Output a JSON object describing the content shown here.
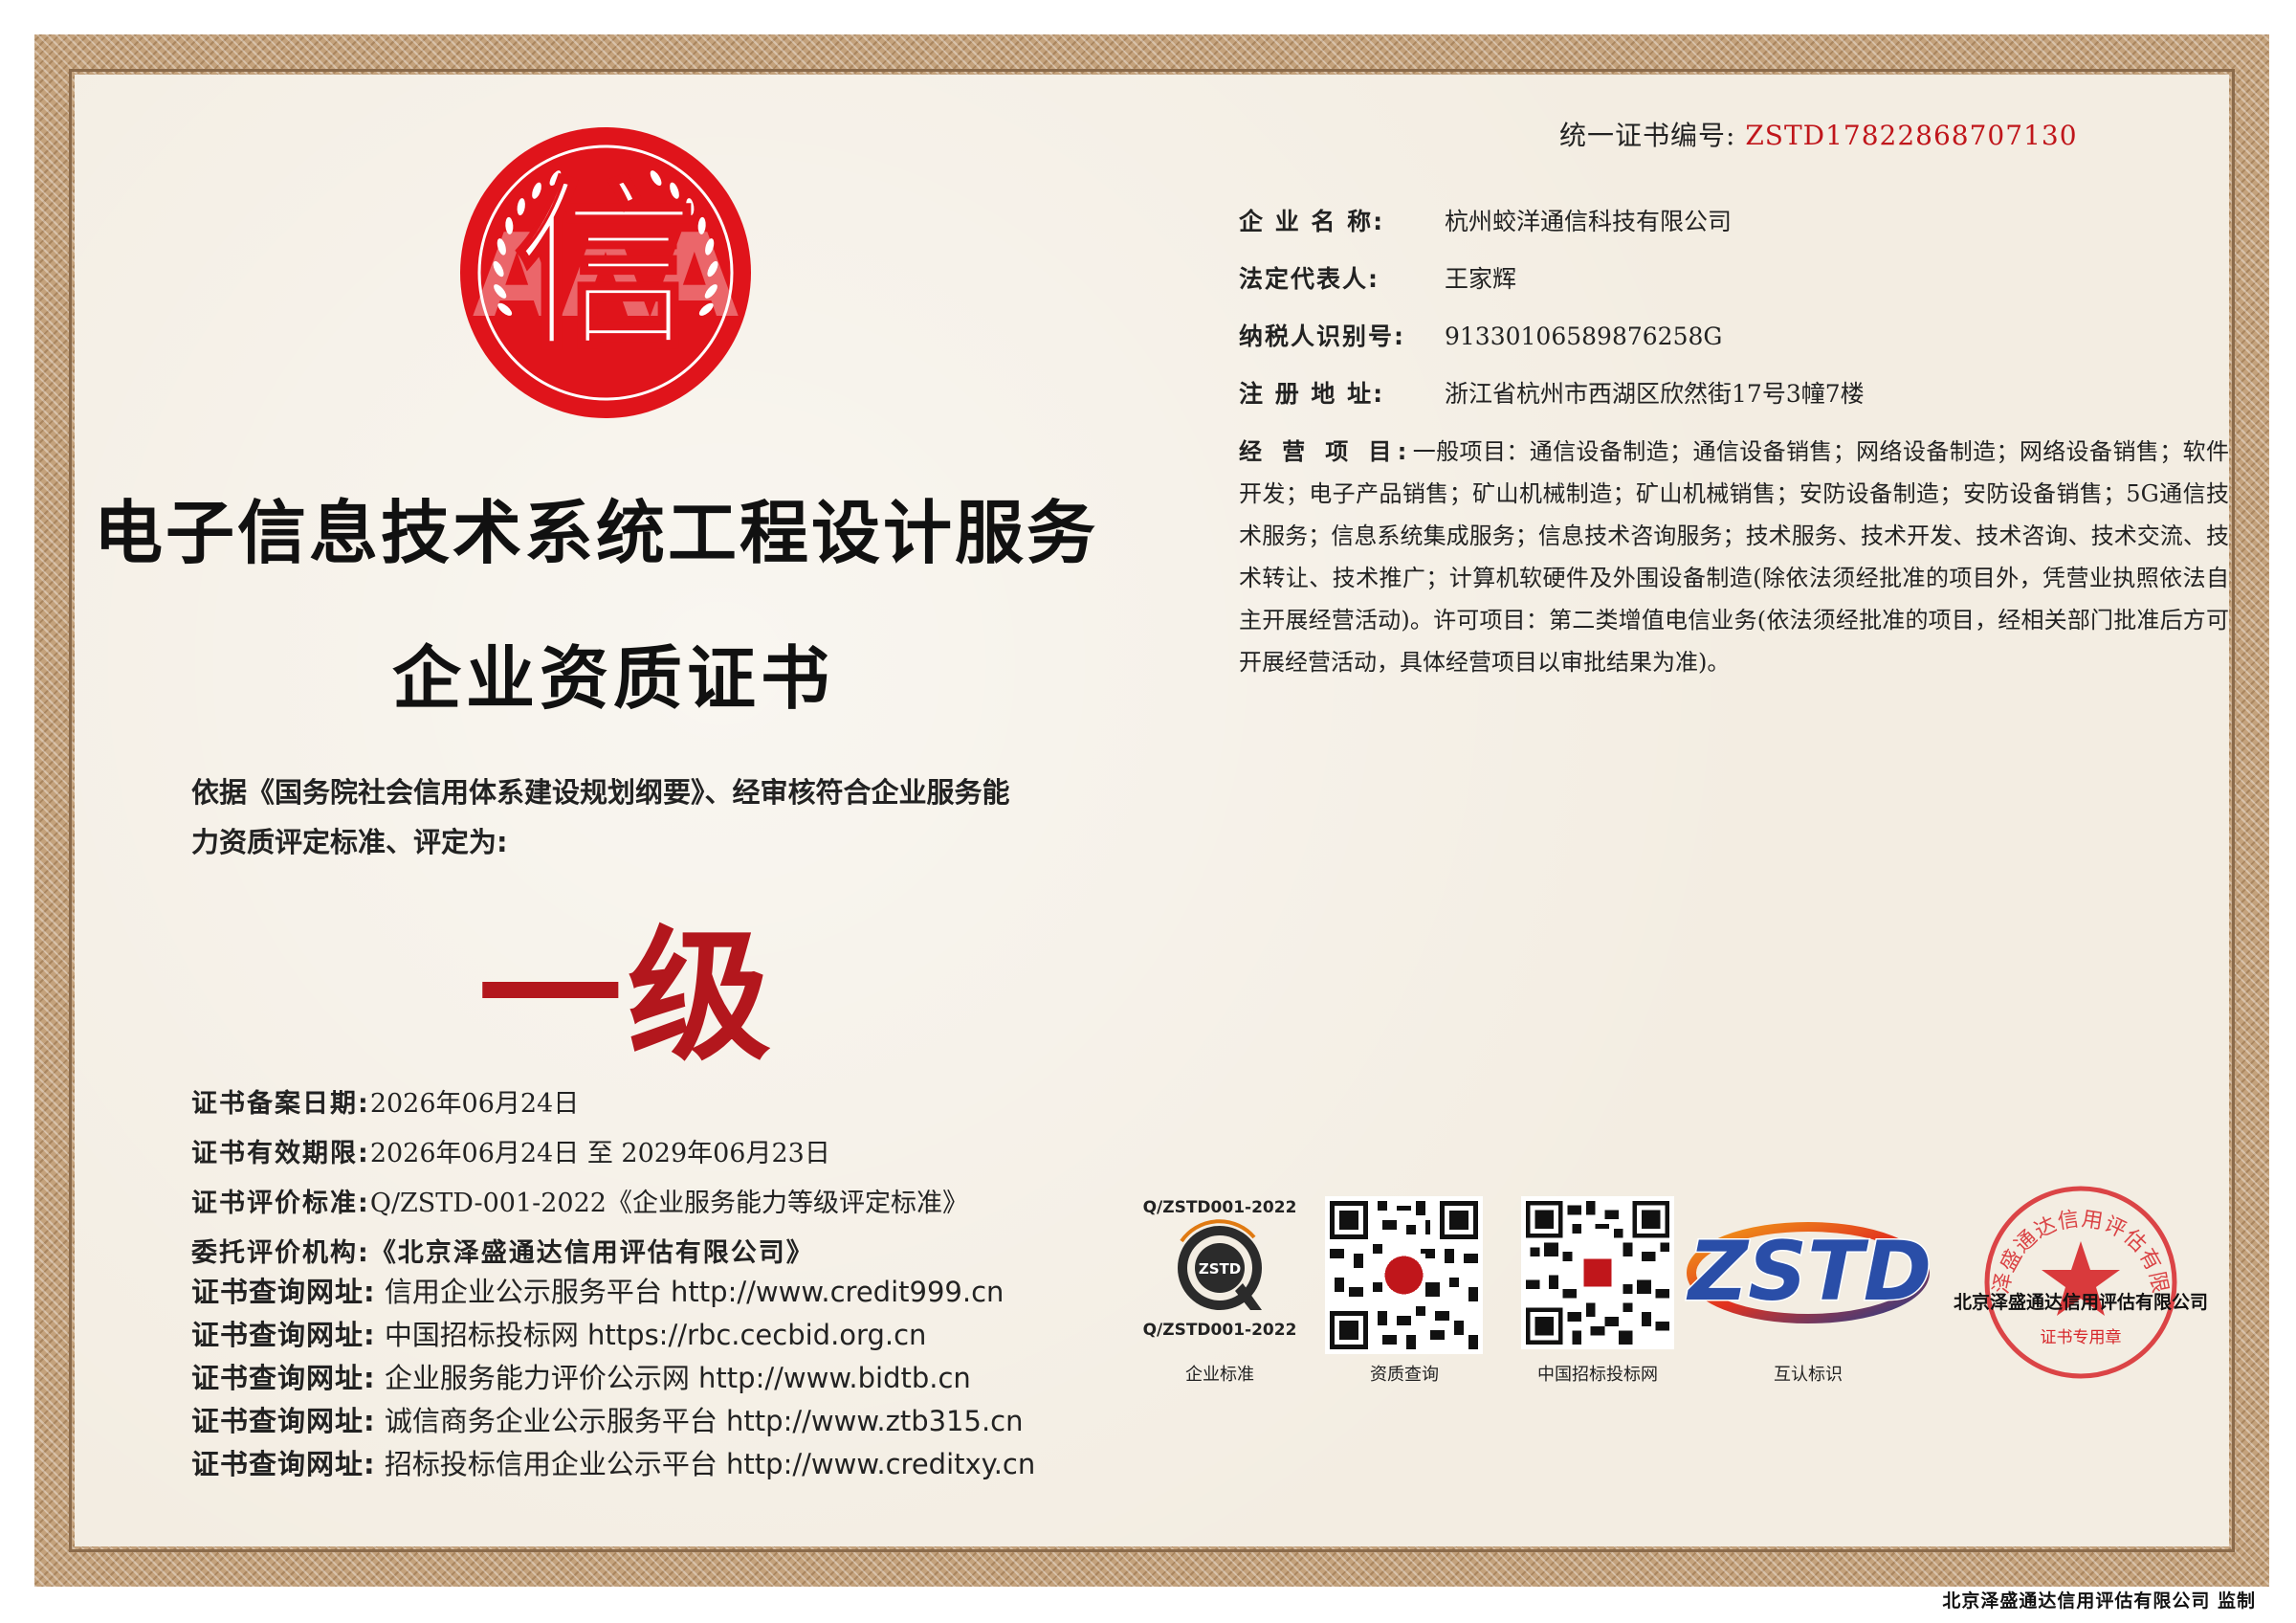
{
  "header": {
    "cert_no_label": "统一证书编号:",
    "cert_no_value": "ZSTD17822868707130"
  },
  "company": {
    "name_label": "企 业 名 称:",
    "name": "杭州蛟洋通信科技有限公司",
    "rep_label": "法定代表人:",
    "rep": "王家辉",
    "tax_label": "纳税人识别号:",
    "tax": "91330106589876258G",
    "addr_label": "注 册 地 址:",
    "addr": "浙江省杭州市西湖区欣然街17号3幢7楼",
    "scope_label": "经 营 项 目:",
    "scope": "一般项目：通信设备制造；通信设备销售；网络设备制造；网络设备销售；软件开发；电子产品销售；矿山机械制造；矿山机械销售；安防设备制造；安防设备销售；5G通信技术服务；信息系统集成服务；信息技术咨询服务；技术服务、技术开发、技术咨询、技术交流、技术转让、技术推广；计算机软硬件及外围设备制造(除依法须经批准的项目外，凭营业执照依法自主开展经营活动)。许可项目：第二类增值电信业务(依法须经批准的项目，经相关部门批准后方可开展经营活动，具体经营项目以审批结果为准)。"
  },
  "seal": {
    "char": "信",
    "text": "AAA"
  },
  "title": {
    "line1": "电子信息技术系统工程设计服务",
    "line2": "企业资质证书"
  },
  "basis": {
    "line1": "依据《国务院社会信用体系建设规划纲要》、经审核符合企业服务能",
    "line2": "力资质评定标准、评定为:"
  },
  "grade": "一级",
  "fields": {
    "filing_label": "证书备案日期:",
    "filing": "2026年06月24日",
    "valid_label": "证书有效期限:",
    "valid": "2026年06月24日 至 2029年06月23日",
    "std_label": "证书评价标准:",
    "std": "Q/ZSTD-001-2022《企业服务能力等级评定标准》",
    "org_label": "委托评价机构:",
    "org": "《北京泽盛通达信用评估有限公司》"
  },
  "urls": [
    {
      "label": "证书查询网址:",
      "value": "信用企业公示服务平台 http://www.credit999.cn"
    },
    {
      "label": "证书查询网址:",
      "value": "中国招标投标网 https://rbc.cecbid.org.cn"
    },
    {
      "label": "证书查询网址:",
      "value": "企业服务能力评价公示网 http://www.bidtb.cn"
    },
    {
      "label": "证书查询网址:",
      "value": "诚信商务企业公示服务平台 http://www.ztb315.cn"
    },
    {
      "label": "证书查询网址:",
      "value": "招标投标信用企业公示平台 http://www.creditxy.cn"
    }
  ],
  "logos": {
    "std_badge_top": "Q/ZSTD001-2022",
    "std_badge_center": "ZSTD",
    "std_badge_bottom": "Q/ZSTD001-2022",
    "std_caption": "企业标准",
    "qr1_caption": "资质查询",
    "qr2_caption": "中国招标投标网",
    "zstd_logo": "ZSTD",
    "zstd_caption": "互认标识",
    "stamp_ring": "北京泽盛通达信用评估有限公司",
    "stamp_caption": "证书专用章"
  },
  "footer": "北京泽盛通达信用评估有限公司 监制"
}
